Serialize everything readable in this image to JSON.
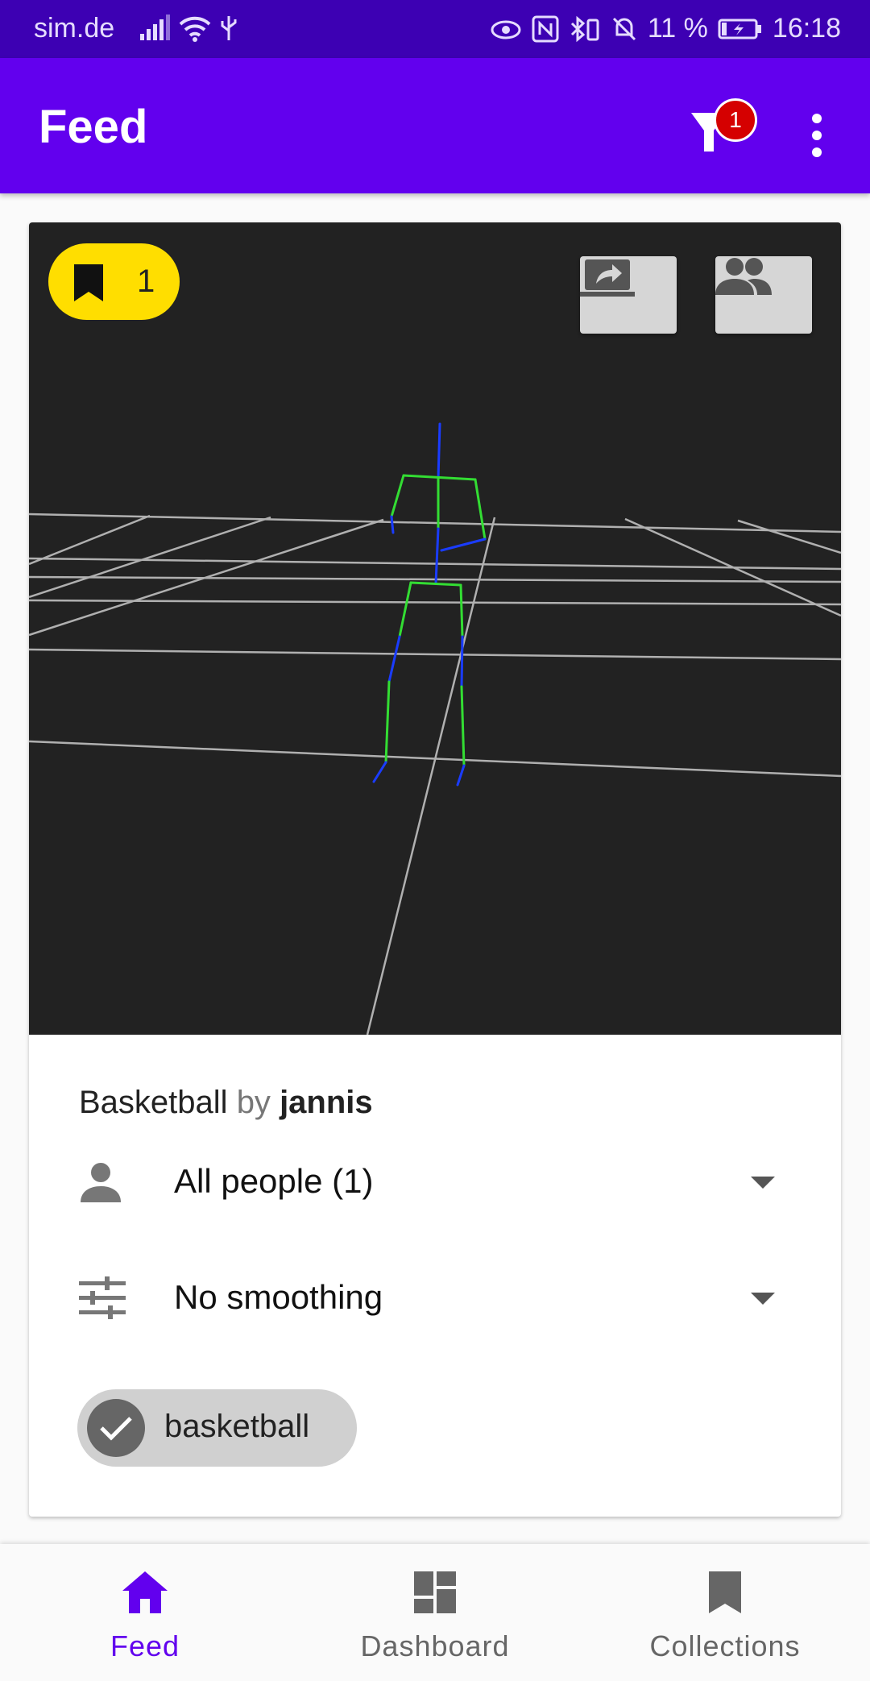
{
  "status_bar": {
    "carrier": "sim.de",
    "battery_percent": "11 %",
    "time": "16:18"
  },
  "app_bar": {
    "title": "Feed",
    "filter_badge_count": "1"
  },
  "card": {
    "collection_count": "1",
    "recording": {
      "name": "Basketball",
      "by": "by",
      "author": "jannis"
    },
    "people_select": "All people (1)",
    "smoothing_select": "No smoothing",
    "tag": "basketball"
  },
  "bottom_nav": {
    "items": [
      {
        "label": "Feed",
        "icon": "home-icon",
        "active": true
      },
      {
        "label": "Dashboard",
        "icon": "dashboard-icon",
        "active": false
      },
      {
        "label": "Collections",
        "icon": "bookmark-icon",
        "active": false
      }
    ]
  },
  "colors": {
    "primary": "#6200ee",
    "status_bar": "#3d00b3",
    "badge": "#d50000",
    "collection_chip": "#ffde00",
    "viewer_bg": "#222222",
    "skeleton_green": "#33dd33",
    "skeleton_blue": "#1a3cff"
  }
}
